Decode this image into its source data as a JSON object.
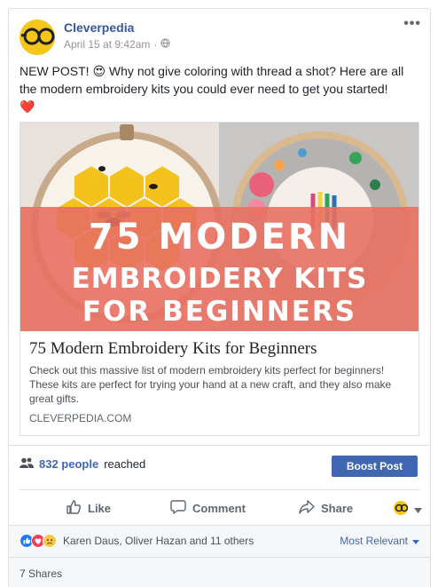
{
  "post": {
    "page_name": "Cleverpedia",
    "date": "April 15 at 9:42am",
    "separator": "·",
    "more_label": "•••",
    "text_line1": "NEW POST! 😍 Why not give coloring with thread a shot? Here are all",
    "text_line2": "the modern embroidery kits you could ever need to get you started!",
    "text_emoji": "❤️"
  },
  "link_preview": {
    "image_line1": "75 MODERN",
    "image_line2": "EMBROIDERY KITS",
    "image_line3": "FOR BEGINNERS",
    "title": "75 Modern Embroidery Kits for Beginners",
    "description": "Check out this massive list of modern embroidery kits perfect for beginners! These kits are perfect for trying your hand at a new craft, and they also make great gifts.",
    "domain": "CLEVERPEDIA.COM"
  },
  "reach": {
    "count": "832 people",
    "suffix": "reached",
    "boost_label": "Boost Post"
  },
  "actions": {
    "like": "Like",
    "comment": "Comment",
    "share": "Share"
  },
  "reactions": {
    "names": "Karen Daus, Oliver Hazan and 11 others",
    "sort_label": "Most Relevant"
  },
  "shares": {
    "label": "7 Shares"
  },
  "colors": {
    "link_blue": "#365899",
    "button_blue": "#4267b2",
    "overlay_coral": "#e87062",
    "brand_yellow": "#f5c518"
  },
  "icons": [
    "globe-icon",
    "people-icon",
    "like-thumb-icon",
    "comment-bubble-icon",
    "share-arrow-icon",
    "caret-down-icon",
    "like-reaction-icon",
    "love-reaction-icon",
    "sad-reaction-icon"
  ]
}
